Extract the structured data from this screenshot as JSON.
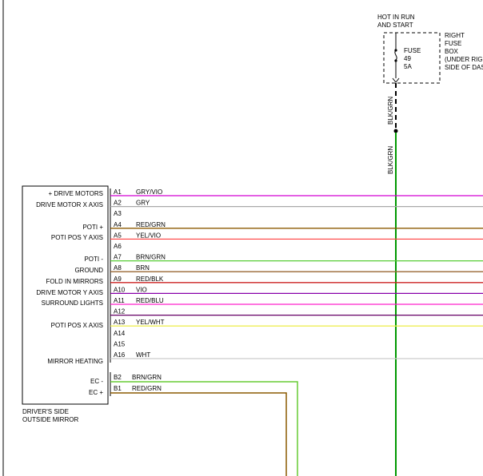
{
  "fuse_source": {
    "line1": "HOT IN RUN",
    "line2": "AND START"
  },
  "fuse_box": {
    "label_lines": [
      "RIGHT",
      "FUSE",
      "BOX",
      "(UNDER RIGHT",
      "SIDE OF DASH)"
    ],
    "fuse": {
      "name": "FUSE",
      "number": "49",
      "rating": "5A"
    }
  },
  "feed_wire": {
    "upper_label": "BLK/GRN",
    "lower_label": "BLK/GRN",
    "color": "#009900"
  },
  "component": {
    "name_line1": "DRIVER'S SIDE",
    "name_line2": "OUTSIDE MIRROR"
  },
  "connector_a": [
    {
      "pin": "A1",
      "function": "+ DRIVE MOTORS",
      "wire": "GRY/VIO",
      "color": "#d400d4"
    },
    {
      "pin": "A2",
      "function": "DRIVE MOTOR X AXIS",
      "wire": "GRY",
      "color": "#aaaaaa"
    },
    {
      "pin": "A3",
      "function": "",
      "wire": "",
      "color": ""
    },
    {
      "pin": "A4",
      "function": "POTI +",
      "wire": "RED/GRN",
      "color": "#8b5a00"
    },
    {
      "pin": "A5",
      "function": "POTI POS Y AXIS",
      "wire": "YEL/VIO",
      "color": "#ff4d4d"
    },
    {
      "pin": "A6",
      "function": "",
      "wire": "",
      "color": ""
    },
    {
      "pin": "A7",
      "function": "POTI -",
      "wire": "BRN/GRN",
      "color": "#55cc33"
    },
    {
      "pin": "A8",
      "function": "GROUND",
      "wire": "BRN",
      "color": "#996633"
    },
    {
      "pin": "A9",
      "function": "",
      "wire": "RED/BLK",
      "color": "#cc2222"
    },
    {
      "pin": "A10",
      "function": "FOLD IN MIRRORS",
      "wire": "VIO",
      "color": "#8800aa"
    },
    {
      "pin": "A11",
      "function": "DRIVE MOTOR Y AXIS",
      "wire": "RED/BLU",
      "color": "#ff22cc"
    },
    {
      "pin": "A12",
      "function": "SURROUND LIGHTS",
      "wire": "",
      "color": "#660066"
    },
    {
      "pin": "A13",
      "function": "",
      "wire": "YEL/WHT",
      "color": "#eeee55"
    },
    {
      "pin": "A14",
      "function": "POTI POS X AXIS",
      "wire": "",
      "color": ""
    },
    {
      "pin": "A15",
      "function": "",
      "wire": "",
      "color": ""
    },
    {
      "pin": "A16",
      "function": "",
      "wire": "WHT",
      "color": "#cccccc"
    }
  ],
  "mirror_heating_label": "MIRROR HEATING",
  "connector_b": [
    {
      "pin": "B2",
      "function": "EC -",
      "wire": "BRN/GRN",
      "color": "#66cc33"
    },
    {
      "pin": "B1",
      "function": "EC +",
      "wire": "RED/GRN",
      "color": "#8b5a00"
    }
  ]
}
